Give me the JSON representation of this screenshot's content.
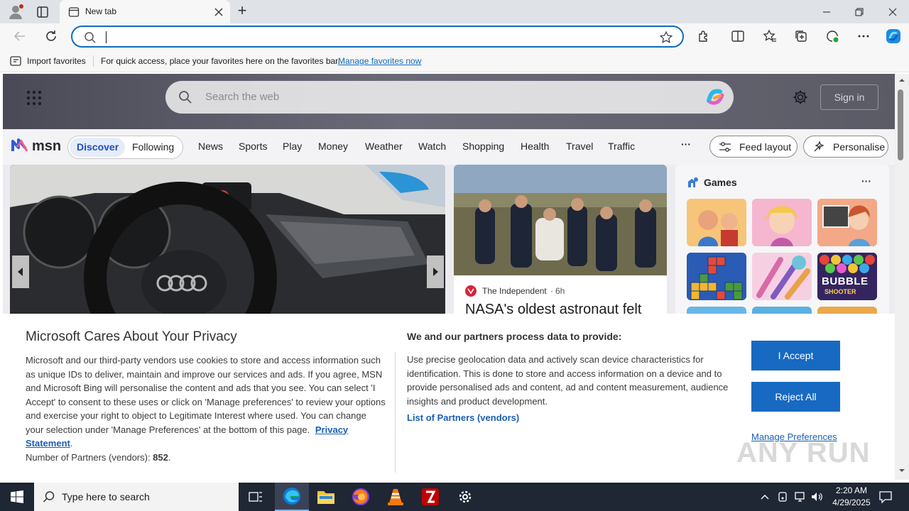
{
  "browser": {
    "tab_title": "New tab",
    "new_tab_symbol": "+",
    "address_value": "",
    "window_controls": [
      "minimize-icon",
      "restore-icon",
      "close-icon"
    ]
  },
  "favorites_bar": {
    "import_label": "Import favorites",
    "hint": "For quick access, place your favorites here on the favorites bar.",
    "manage_link": "Manage favorites now"
  },
  "msn": {
    "search_placeholder": "Search the web",
    "sign_in": "Sign in",
    "logo_text": "msn",
    "tabs": [
      "Discover",
      "Following"
    ],
    "nav": [
      "News",
      "Sports",
      "Play",
      "Money",
      "Weather",
      "Watch",
      "Shopping",
      "Health",
      "Travel",
      "Traffic"
    ],
    "more": "···",
    "feed_layout": "Feed layout",
    "personalise": "Personalise",
    "story": {
      "source": "The Independent",
      "age": "6h",
      "headline": "NASA's oldest astronaut felt"
    },
    "games": {
      "title": "Games",
      "more": "···",
      "bubble_title": "BUBBLE",
      "bubble_sub": "SHOOTER"
    }
  },
  "privacy": {
    "title": "Microsoft Cares About Your Privacy",
    "body": "Microsoft and our third-party vendors use cookies to store and access information such as unique IDs to deliver, maintain and improve our services and ads. If you agree, MSN and Microsoft Bing will personalise the content and ads that you see. You can select 'I Accept' to consent to these uses or click on 'Manage preferences' to review your options and exercise your right to object to Legitimate Interest where used.  You can change your selection under 'Manage Preferences' at the bottom of this page.",
    "privacy_link": "Privacy Statement",
    "partners_label": "Number of Partners (vendors):",
    "partners_count": "852",
    "right_title": "We and our partners process data to provide:",
    "right_body": "Use precise geolocation data and actively scan device characteristics for identification. This is done to store and access information on a device and to provide personalised ads and content, ad and content measurement, audience insights and product development.",
    "list_link": "List of Partners (vendors)",
    "accept": "I Accept",
    "reject": "Reject All",
    "manage": "Manage Preferences"
  },
  "watermark": "ANY RUN",
  "taskbar": {
    "search_placeholder": "Type here to search",
    "time": "2:20 AM",
    "date": "4/29/2025"
  },
  "colors": {
    "accent": "#0f6cbd",
    "button_blue": "#1769c2",
    "taskbar": "#1f2634"
  }
}
